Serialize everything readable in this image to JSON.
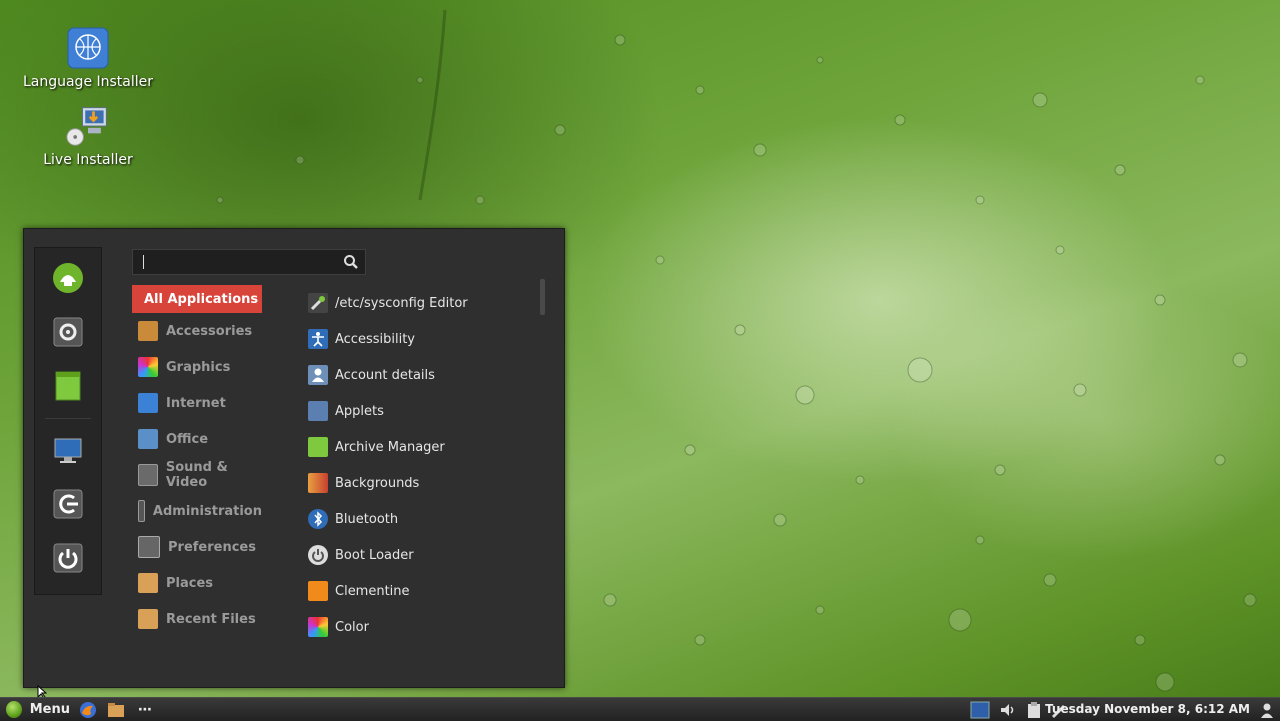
{
  "desktop": {
    "icons": [
      {
        "label": "Language Installer",
        "icon": "un-globe-icon"
      },
      {
        "label": "Live Installer",
        "icon": "installer-icon"
      }
    ]
  },
  "menu": {
    "search": {
      "value": ""
    },
    "favorites": [
      {
        "name": "mintinstall-icon"
      },
      {
        "name": "system-settings-icon"
      },
      {
        "name": "notepad-icon"
      },
      {
        "name": "display-icon"
      },
      {
        "name": "logout-icon"
      },
      {
        "name": "power-icon"
      }
    ],
    "categories": [
      {
        "label": "All Applications",
        "selected": true
      },
      {
        "label": "Accessories"
      },
      {
        "label": "Graphics"
      },
      {
        "label": "Internet"
      },
      {
        "label": "Office"
      },
      {
        "label": "Sound & Video"
      },
      {
        "label": "Administration"
      },
      {
        "label": "Preferences"
      },
      {
        "label": "Places"
      },
      {
        "label": "Recent Files"
      }
    ],
    "apps": [
      {
        "label": "/etc/sysconfig Editor"
      },
      {
        "label": "Accessibility"
      },
      {
        "label": "Account details"
      },
      {
        "label": "Applets"
      },
      {
        "label": "Archive Manager"
      },
      {
        "label": "Backgrounds"
      },
      {
        "label": "Bluetooth"
      },
      {
        "label": "Boot Loader"
      },
      {
        "label": "Clementine"
      },
      {
        "label": "Color"
      }
    ]
  },
  "taskbar": {
    "menu_label": "Menu",
    "clock": "Tuesday November  8,  6:12 AM"
  },
  "colors": {
    "accent": "#d8433a",
    "panel": "#2f2f2f"
  }
}
